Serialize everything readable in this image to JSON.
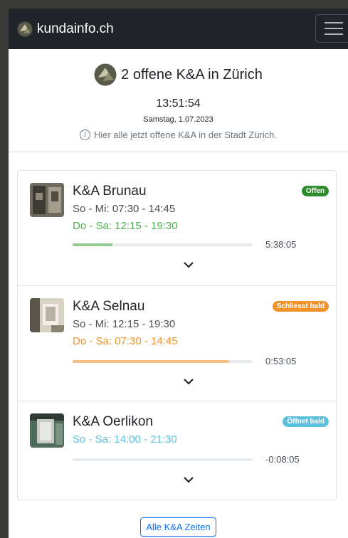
{
  "navbar": {
    "brand": "kundainfo.ch",
    "menu_icon": "hamburger-icon"
  },
  "header": {
    "title": "2 offene K&A in Zürich",
    "time": "13:51:54",
    "date": "Samstag, 1.07.2023",
    "hint": "Hier alle jetzt offene K&A in der Stadt Zürich.",
    "hint_icon": "info-icon"
  },
  "locations": [
    {
      "name": "K&A Brunau",
      "badge": "Offen",
      "badge_color": "#2e8b2e",
      "line1": "So - Mi: 07:30 - 14:45",
      "line1_color": "#495057",
      "line2": "Do - Sa: 12:15 - 19:30",
      "line2_color": "#4caf50",
      "progress": 0.22,
      "progress_color": "#8fc98f",
      "remaining": "5:38:05"
    },
    {
      "name": "K&A Selnau",
      "badge": "Schliesst bald",
      "badge_color": "#f0932b",
      "line1": "So - Mi: 12:15 - 19:30",
      "line1_color": "#495057",
      "line2": "Do - Sa: 07:30 - 14:45",
      "line2_color": "#f0932b",
      "progress": 0.87,
      "progress_color": "#f5c087",
      "remaining": "0:53:05"
    },
    {
      "name": "K&A Oerlikon",
      "badge": "Öffnet bald",
      "badge_color": "#5bc0de",
      "line1": "So - Sa: 14:00 - 21:30",
      "line1_color": "#5bc0de",
      "line2": "",
      "line2_color": "",
      "progress": 0,
      "progress_color": "#5bc0de",
      "remaining": "-0:08:05"
    }
  ],
  "footer": {
    "all_button": "Alle K&A Zeiten"
  }
}
